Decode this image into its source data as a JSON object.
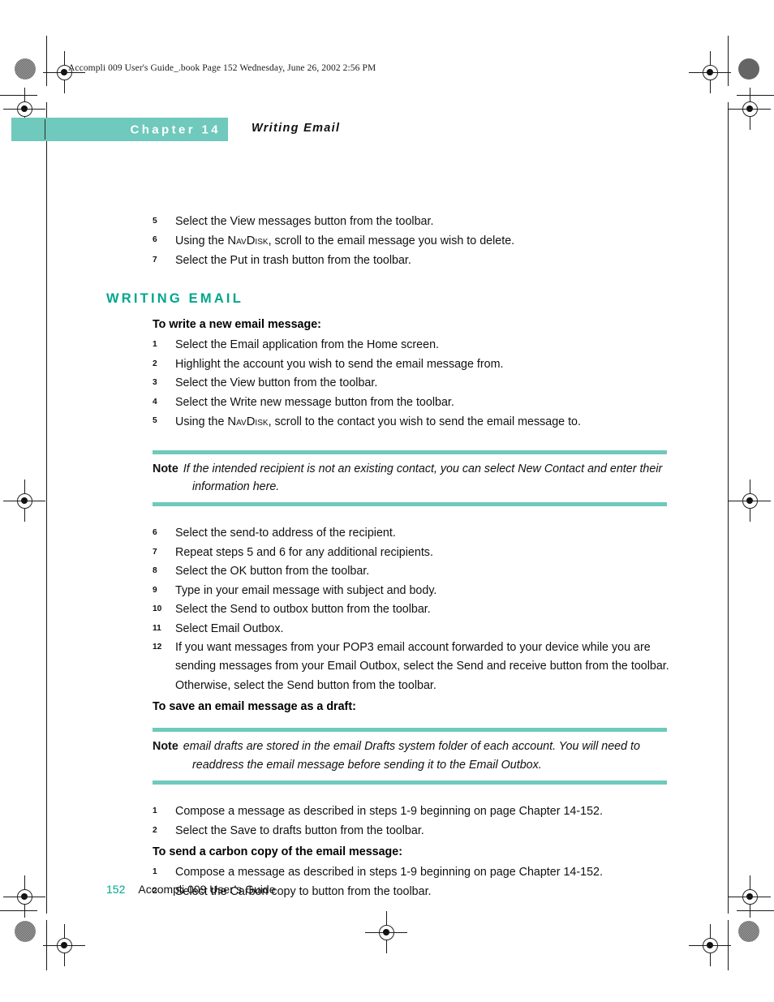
{
  "doc_header": "Accompli 009 User's Guide_.book  Page 152  Wednesday, June 26, 2002  2:56 PM",
  "chapter": {
    "band_label": "Chapter 14",
    "title": "Writing Email"
  },
  "colors": {
    "band_teal": "#6FC9BC",
    "heading_teal": "#00A68D",
    "body_text": "#111111"
  },
  "top_steps": [
    {
      "num": "5",
      "text": "Select the View messages button from the toolbar."
    },
    {
      "num": "6",
      "pre": "Using the ",
      "sc": "NavDisk",
      "post": ", scroll to the email message you wish to delete."
    },
    {
      "num": "7",
      "text": "Select the Put in trash button from the toolbar."
    }
  ],
  "section": {
    "heading": "WRITING EMAIL"
  },
  "subhead_write": "To write a new email message:",
  "write_steps": [
    {
      "num": "1",
      "text": "Select the Email application from the Home screen."
    },
    {
      "num": "2",
      "text": "Highlight the account you wish to send the email message from."
    },
    {
      "num": "3",
      "text": "Select the View button from the toolbar."
    },
    {
      "num": "4",
      "text": "Select the Write new message button from the toolbar."
    },
    {
      "num": "5",
      "pre": "Using the ",
      "sc": "NavDisk",
      "post": ", scroll to the contact you wish to send the email message to."
    }
  ],
  "note_1": {
    "label": "Note",
    "text": "If the intended recipient is not an existing contact, you can select New Contact and enter their information here."
  },
  "write_steps_cont": [
    {
      "num": "6",
      "text": "Select the send-to address of the recipient."
    },
    {
      "num": "7",
      "text": "Repeat steps 5 and 6 for any additional recipients."
    },
    {
      "num": "8",
      "text": "Select the OK button from the toolbar."
    },
    {
      "num": "9",
      "text": "Type in your email message with subject and body."
    },
    {
      "num": "10",
      "text": "Select the Send to outbox button from the toolbar."
    },
    {
      "num": "11",
      "text": "Select Email Outbox."
    },
    {
      "num": "12",
      "text": "If you want messages from your POP3 email account forwarded to your device while you are sending messages from your Email Outbox, select the Send and receive button from the toolbar. Otherwise, select the Send button from the toolbar."
    }
  ],
  "subhead_draft": "To save an email message as a draft:",
  "note_2": {
    "label": "Note",
    "text": "email drafts are stored in the email Drafts system folder of each account. You will need to readdress the email message before sending it to the Email Outbox."
  },
  "draft_steps": [
    {
      "num": "1",
      "text": "Compose a message as described in steps 1-9 beginning on page Chapter 14-152."
    },
    {
      "num": "2",
      "text": "Select the Save to drafts button from the toolbar."
    }
  ],
  "subhead_cc": "To send a carbon copy of the email message:",
  "cc_steps": [
    {
      "num": "1",
      "text": "Compose a message as described in steps 1-9 beginning on page Chapter 14-152."
    },
    {
      "num": "2",
      "text": "Select the Carbon copy to button from the toolbar."
    }
  ],
  "footer": {
    "page_number": "152",
    "book_title": "Accompli 009 User’s Guide"
  }
}
